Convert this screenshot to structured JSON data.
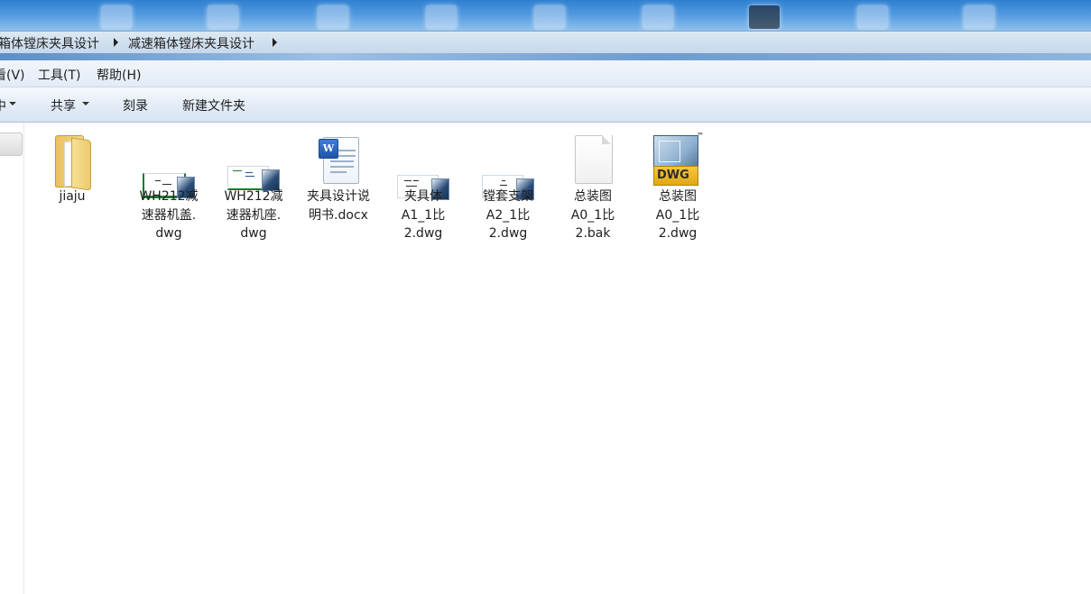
{
  "breadcrumb": {
    "items": [
      "箱体镗床夹具设计",
      "减速箱体镗床夹具设计"
    ]
  },
  "menu": {
    "items": [
      "看(V)",
      "工具(T)",
      "帮助(H)"
    ]
  },
  "toolbar": {
    "partial_left": "中",
    "share_label": "共享",
    "burn_label": "刻录",
    "new_folder_label": "新建文件夹"
  },
  "files": [
    {
      "name": "jiaju",
      "icon": "folder-icon"
    },
    {
      "name": "WH212减速器机盖.dwg",
      "icon": "dwg-thumbnail-icon"
    },
    {
      "name": "WH212减速器机座.dwg",
      "icon": "dwg-thumbnail-icon"
    },
    {
      "name": "夹具设计说明书.docx",
      "icon": "word-document-icon"
    },
    {
      "name": "夹具体A1_1比2.dwg",
      "icon": "dwg-thumbnail-icon"
    },
    {
      "name": "镗套支架A2_1比2.dwg",
      "icon": "dwg-thumbnail-icon"
    },
    {
      "name": "总装图A0_1比2.bak",
      "icon": "blank-file-icon"
    },
    {
      "name": "总装图A0_1比2.dwg",
      "icon": "dwg-app-icon"
    }
  ],
  "file_labels": [
    "jiaju",
    "WH212减\n速器机盖.\ndwg",
    "WH212减\n速器机座.\ndwg",
    "夹具设计说\n明书.docx",
    "夹具体\nA1_1比\n2.dwg",
    "镗套支架\nA2_1比\n2.dwg",
    "总装图\nA0_1比\n2.bak",
    "总装图\nA0_1比\n2.dwg"
  ],
  "icons": {
    "dwg_badge_text": "DWG",
    "word_badge_text": "W",
    "trademark": "™"
  },
  "colors": {
    "titlebar": "#2f7fd0",
    "toolbar": "#e3ecf7",
    "folder": "#f4d98a",
    "dwg_band": "#f6c63a"
  }
}
